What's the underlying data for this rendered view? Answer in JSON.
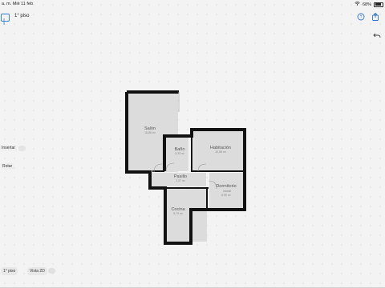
{
  "status": {
    "time": "a. m.",
    "date": "Mié 11 feb",
    "battery": "68%"
  },
  "header": {
    "floor_name": "1° piso",
    "sidebar_icon": "sidebar-toggle-icon",
    "help_icon": "help-icon",
    "share_icon": "share-icon",
    "undo_icon": "undo-icon"
  },
  "tools": {
    "insert_label": "Insertar",
    "rotate_label": "Rotar"
  },
  "footer": {
    "floor_label": "1° piso",
    "view_label": "Vista 2D"
  },
  "rooms": [
    {
      "id": "salon",
      "label": "Salón",
      "area": "18,86 m²"
    },
    {
      "id": "bano",
      "label": "Baño",
      "area": "3,33 m²"
    },
    {
      "id": "habitacion",
      "label": "Habitación",
      "area": "10,58 m²"
    },
    {
      "id": "pasillo",
      "label": "Pasillo",
      "area": "2,37 m²"
    },
    {
      "id": "dormitorio",
      "label": "Dormitorio",
      "label2": "infantil",
      "area": "6,05 m²"
    },
    {
      "id": "cocina",
      "label": "Cocina",
      "area": "5,79 m²"
    }
  ],
  "colors": {
    "accent": "#2f73c5",
    "wall": "#111111",
    "floor": "#dcdcdc"
  }
}
